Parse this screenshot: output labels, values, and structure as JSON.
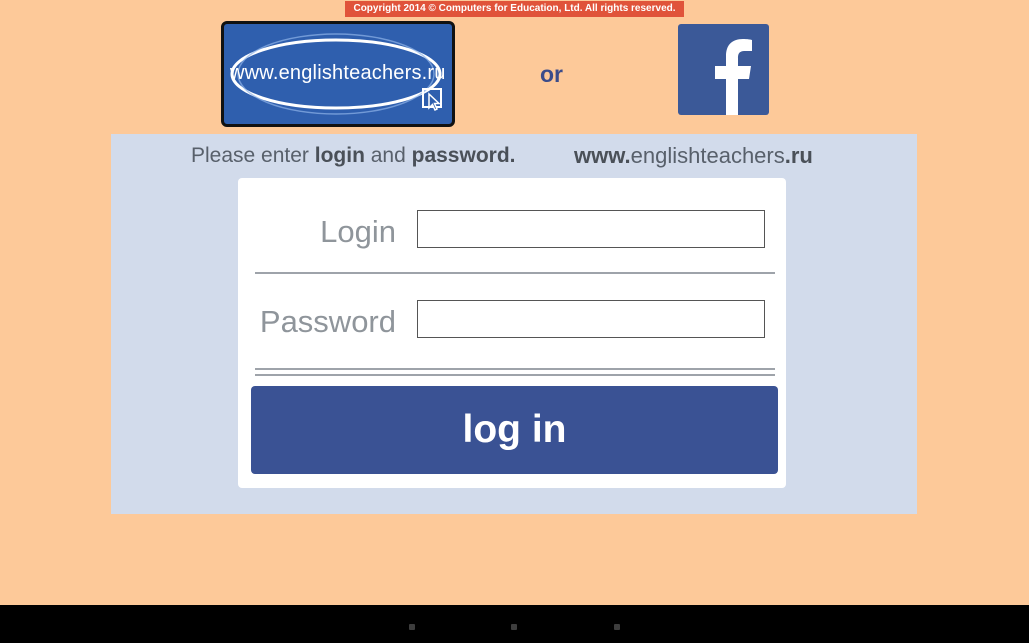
{
  "copyright": "Copyright 2014 © Computers for Education, Ltd. All rights reserved.",
  "logo": {
    "text": "www.englishteachers.ru",
    "icon": "cursor-icon"
  },
  "or_text": "or",
  "facebook": {
    "icon": "facebook-icon",
    "glyph": "f"
  },
  "prompt": {
    "part1": "Please enter ",
    "bold1": "login",
    "part2": " and ",
    "bold2": "password",
    "part3": ".",
    "site_prefix": "www.",
    "site_middle": "englishteachers",
    "site_suffix": ".ru"
  },
  "form": {
    "login_label": "Login",
    "login_value": "",
    "password_label": "Password",
    "password_value": "",
    "submit_label": "log in"
  },
  "colors": {
    "background": "#fdc999",
    "panel": "#d2dbeb",
    "button": "#3a5294",
    "facebook": "#3b5998",
    "copyright_bar": "#e0533a"
  },
  "navbar": {
    "buttons": [
      "back-icon",
      "home-icon",
      "recent-apps-icon"
    ]
  }
}
